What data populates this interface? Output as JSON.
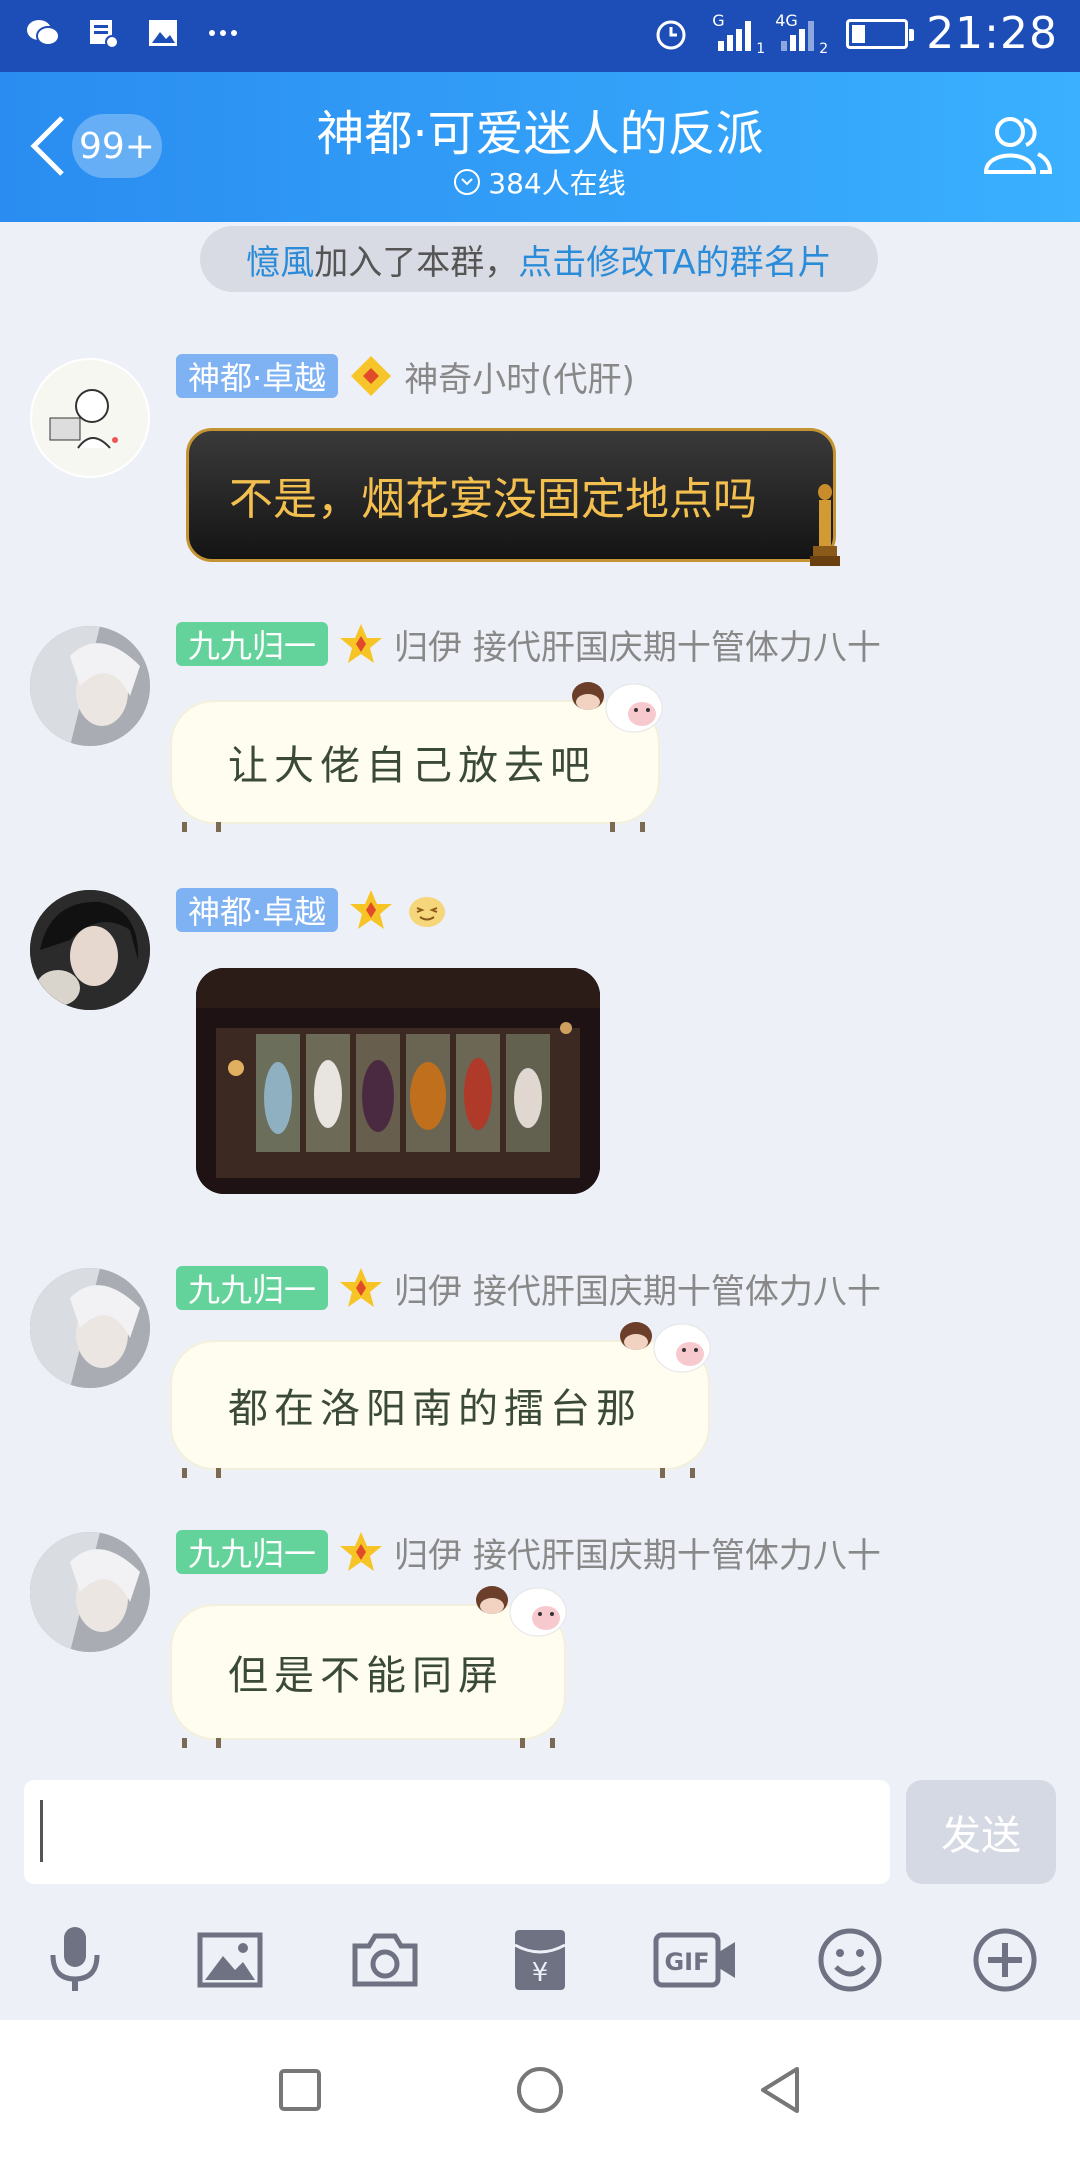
{
  "status_bar": {
    "time": "21:28",
    "signal1_label": "G",
    "signal1_sub": "1",
    "signal2_label": "4G",
    "signal2_sub": "2",
    "battery_level": 0.25,
    "icons": [
      "wechat-icon",
      "notification-icon",
      "image-icon",
      "more-icon",
      "alarm-icon"
    ]
  },
  "header": {
    "unread_badge": "99+",
    "title": "神都·可爱迷人的反派",
    "online_text": "384人在线"
  },
  "notice": {
    "user": "憶風",
    "text": " 加入了本群，",
    "link": "点击修改TA的群名片"
  },
  "messages": [
    {
      "tag": "神都·卓越",
      "tag_color": "#7fb2f3",
      "sender": "神奇小时(代肝)",
      "text": "不是，烟花宴没固定地点吗"
    },
    {
      "tag": "九九归一",
      "tag_color": "#63d39b",
      "sender": "归伊 接代肝国庆期十管体力八十",
      "text": "让大佬自己放去吧"
    },
    {
      "tag": "神都·卓越",
      "tag_color": "#7fb2f3",
      "sender": "",
      "text": ""
    },
    {
      "tag": "九九归一",
      "tag_color": "#63d39b",
      "sender": "归伊 接代肝国庆期十管体力八十",
      "text": "都在洛阳南的擂台那"
    },
    {
      "tag": "九九归一",
      "tag_color": "#63d39b",
      "sender": "归伊 接代肝国庆期十管体力八十",
      "text": "但是不能同屏"
    }
  ],
  "input": {
    "placeholder": "",
    "send_label": "发送"
  },
  "toolbar": [
    "microphone-icon",
    "image-icon",
    "camera-icon",
    "red-packet-icon",
    "gif-icon",
    "emoji-icon",
    "plus-icon"
  ],
  "navbar": [
    "recent-apps-icon",
    "home-icon",
    "back-icon"
  ]
}
